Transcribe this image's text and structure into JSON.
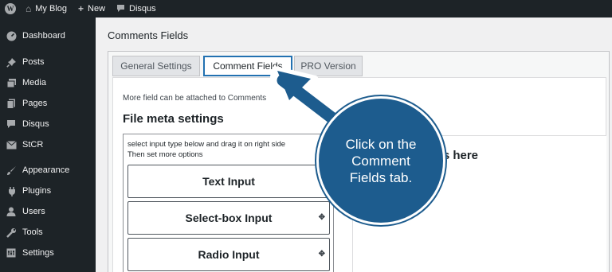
{
  "admin_bar": {
    "site_name": "My Blog",
    "new_label": "New",
    "disqus_label": "Disqus"
  },
  "sidebar": {
    "items": [
      {
        "label": "Dashboard",
        "icon": "dashboard-icon"
      },
      {
        "label": "Posts",
        "icon": "pin-icon"
      },
      {
        "label": "Media",
        "icon": "media-icon"
      },
      {
        "label": "Pages",
        "icon": "pages-icon"
      },
      {
        "label": "Disqus",
        "icon": "comment-icon"
      },
      {
        "label": "StCR",
        "icon": "mail-icon"
      },
      {
        "label": "Appearance",
        "icon": "brush-icon"
      },
      {
        "label": "Plugins",
        "icon": "plug-icon"
      },
      {
        "label": "Users",
        "icon": "user-icon"
      },
      {
        "label": "Tools",
        "icon": "wrench-icon"
      },
      {
        "label": "Settings",
        "icon": "settings-icon"
      }
    ]
  },
  "page": {
    "title": "Comments Fields",
    "tabs": [
      {
        "label": "General Settings",
        "active": false
      },
      {
        "label": "Comment Fields",
        "active": true
      },
      {
        "label": "PRO Version",
        "active": false
      }
    ],
    "description": "More field can be attached to Comments",
    "section_title": "File meta settings",
    "hint_line1": "select input type below and drag it on right side",
    "hint_line2": "Then set more options",
    "input_types": [
      "Text Input",
      "Select-box Input",
      "Radio Input"
    ],
    "drop_title": "fields here"
  },
  "annotation": {
    "text": "Click on the Comment Fields tab."
  },
  "colors": {
    "admin_dark": "#1d2327",
    "accent_blue": "#2271b1",
    "callout_blue": "#1d5c8e"
  }
}
